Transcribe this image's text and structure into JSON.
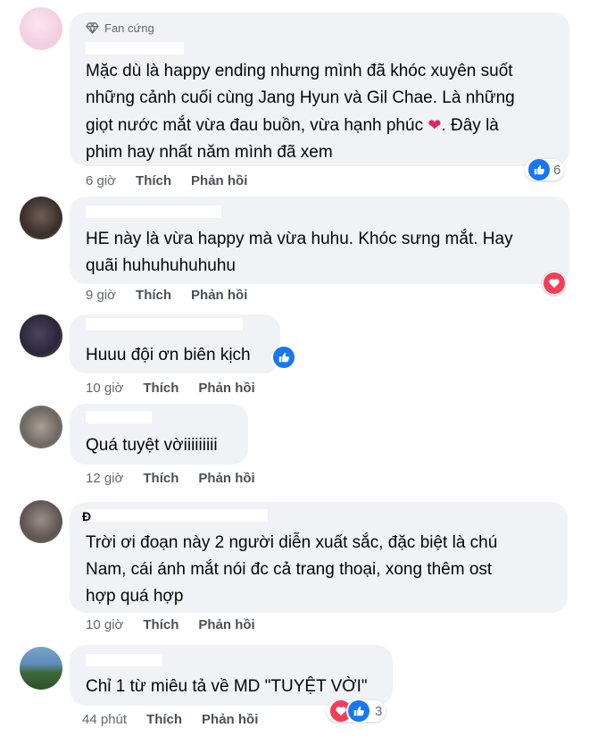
{
  "comments": [
    {
      "badge": "Fan cứng",
      "text": "Mặc dù là happy ending nhưng mình đã khóc xuyên suốt\nnhững cảnh cuối cùng Jang Hyun và Gil Chae. Là những\ngiọt nước mắt vừa đau buồn, vừa hạnh phúc ",
      "text_tail": ". Đây là\nphim hay nhất năm mình đã xem",
      "time": "6 giờ",
      "like": "Thích",
      "reply": "Phản hồi",
      "reaction_count": "6"
    },
    {
      "text": "HE này là vừa happy mà vừa huhu. Khóc sưng mắt. Hay\nquãi huhuhuhuhuhu",
      "time": "9 giờ",
      "like": "Thích",
      "reply": "Phản hồi"
    },
    {
      "text": "Huuu đội ơn biên kịch",
      "time": "10 giờ",
      "like": "Thích",
      "reply": "Phản hồi"
    },
    {
      "text": "Quá tuyệt vờiiiiiiiii",
      "time": "12 giờ",
      "like": "Thích",
      "reply": "Phản hồi"
    },
    {
      "name_fragment": "Đ",
      "text": "Trời ơi đoạn này 2 người diễn xuất sắc, đặc biệt là chú\nNam, cái ánh mắt nói đc cả trang thoại, xong thêm ost\nhợp quá hợp",
      "time": "10 giờ",
      "like": "Thích",
      "reply": "Phản hồi"
    },
    {
      "text": "Chỉ 1 từ miêu tả về MD \"TUYỆT VỜI\"",
      "time": "44 phút",
      "like": "Thích",
      "reply": "Phản hồi",
      "reaction_count": "3"
    }
  ],
  "icons": {
    "badge": "diamond-icon",
    "like": "thumbs-up-icon",
    "love": "heart-icon"
  },
  "colors": {
    "bubble": "#f0f2f5",
    "like_blue": "#1877f2",
    "love_red": "#f33e58",
    "meta_gray": "#65676b"
  }
}
